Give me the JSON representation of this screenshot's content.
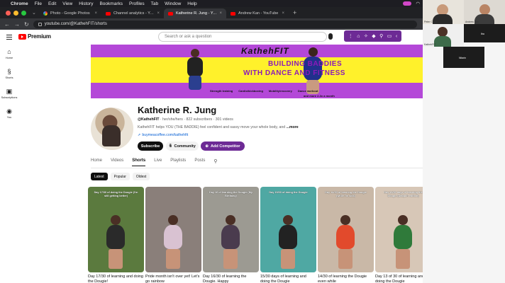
{
  "menubar": {
    "app": "Chrome",
    "items": [
      "File",
      "Edit",
      "View",
      "History",
      "Bookmarks",
      "Profiles",
      "Tab",
      "Window",
      "Help"
    ]
  },
  "tabs": [
    {
      "title": "Photo - Google Photos",
      "active": false,
      "icon": "photos-icon"
    },
    {
      "title": "Channel analytics - YouTube Studio",
      "active": false,
      "icon": "youtube-icon"
    },
    {
      "title": "Katherine R. Jung - YouTube",
      "active": true,
      "icon": "youtube-icon"
    },
    {
      "title": "Andrew Kan - YouTube",
      "active": false,
      "icon": "youtube-icon"
    }
  ],
  "address": {
    "url": "youtube.com/@KathehFIT/shorts"
  },
  "youtube": {
    "logo": "Premium",
    "search_placeholder": "Search or ask a question",
    "leftnav": [
      {
        "label": "Home",
        "icon": "home-icon"
      },
      {
        "label": "Shorts",
        "icon": "shorts-icon"
      },
      {
        "label": "Subscriptions",
        "icon": "subscriptions-icon"
      },
      {
        "label": "You",
        "icon": "you-icon"
      }
    ]
  },
  "banner": {
    "brand": "KathehFIT",
    "line1": "BUILDING BADDIES",
    "line2": "WITH DANCE AND FITNESS",
    "tags": [
      "Strength training",
      "Cardio/kickboxing",
      "Mobility/recovery",
      "Dance workout"
    ],
    "tag_extra": "and more 2-3x a month"
  },
  "channel": {
    "name": "Katherine R. Jung",
    "handle": "@KathehFIT",
    "pronouns": "her/she/hers",
    "subscribers": "822 subscribers",
    "videos": "301 videos",
    "description": "KathehFIT helps YOU (THE BADDIE) feel confident and sassy move your whole body, and",
    "more": "...more",
    "link": "buymeacoffee.com/kathehfit",
    "subscribe_label": "Subscribe",
    "community_label": "Community",
    "add_competitor_label": "Add Competitor"
  },
  "channel_tabs": [
    {
      "label": "Home",
      "active": false
    },
    {
      "label": "Videos",
      "active": false
    },
    {
      "label": "Shorts",
      "active": true
    },
    {
      "label": "Live",
      "active": false
    },
    {
      "label": "Playlists",
      "active": false
    },
    {
      "label": "Posts",
      "active": false
    }
  ],
  "sort_chips": [
    {
      "label": "Latest",
      "active": true
    },
    {
      "label": "Popular",
      "active": false
    },
    {
      "label": "Oldest",
      "active": false
    }
  ],
  "shorts": [
    {
      "title": "Day 17/30 of learning and doing the Dougie!",
      "caption": "Day 17/30 of doing the Dougie (I'm still getting better)",
      "bg": "#5b7a3e",
      "accent": "#2a2a2a"
    },
    {
      "title": "Pride month isn't over yet! Let's go rainbow",
      "caption": "",
      "bg": "#8a7f7a",
      "accent": "#d9c2d2"
    },
    {
      "title": "Day 16/30 of learning the Dougie. Happy",
      "caption": "Day 16 of learning the Dougie (My Birthday)",
      "bg": "#9c9a92",
      "accent": "#4a3b4e"
    },
    {
      "title": "15/30 days of learning and doing the Dougie",
      "caption": "Day 15/30 of doing the Dougie",
      "bg": "#4fa8a3",
      "accent": "#222222"
    },
    {
      "title": "14/30 of learning the Dougie even while",
      "caption": "Day 14/30 of learning the Dougie (while I'm sick)",
      "bg": "#c9b8a7",
      "accent": "#e24a2c"
    },
    {
      "title": "Day 13 of 30 of learning and doing the Dougie",
      "caption": "Day 13/30 days of learning the Dougie (Daiquiri edition)",
      "bg": "#d7c7b7",
      "accent": "#2f7a3a"
    }
  ],
  "zoom": {
    "participants": [
      "Peter Chau",
      "Andrew Kan",
      "Iba",
      "KathehFIT",
      "Nitarin"
    ]
  }
}
